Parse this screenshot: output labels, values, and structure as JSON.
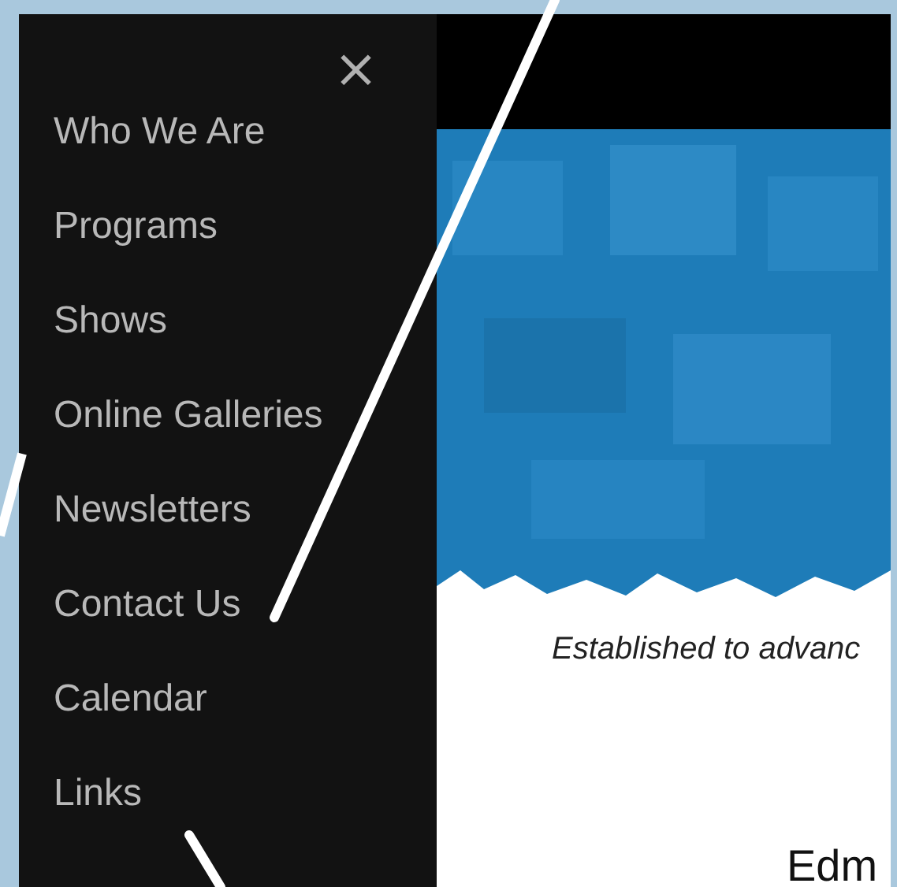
{
  "menu": {
    "close": "×",
    "items": [
      {
        "label": "Who We Are"
      },
      {
        "label": "Programs"
      },
      {
        "label": "Shows"
      },
      {
        "label": "Online Galleries"
      },
      {
        "label": "Newsletters"
      },
      {
        "label": "Contact Us"
      },
      {
        "label": "Calendar"
      },
      {
        "label": "Links"
      }
    ]
  },
  "page": {
    "tagline": "Established to advanc",
    "heading": "Edm"
  }
}
